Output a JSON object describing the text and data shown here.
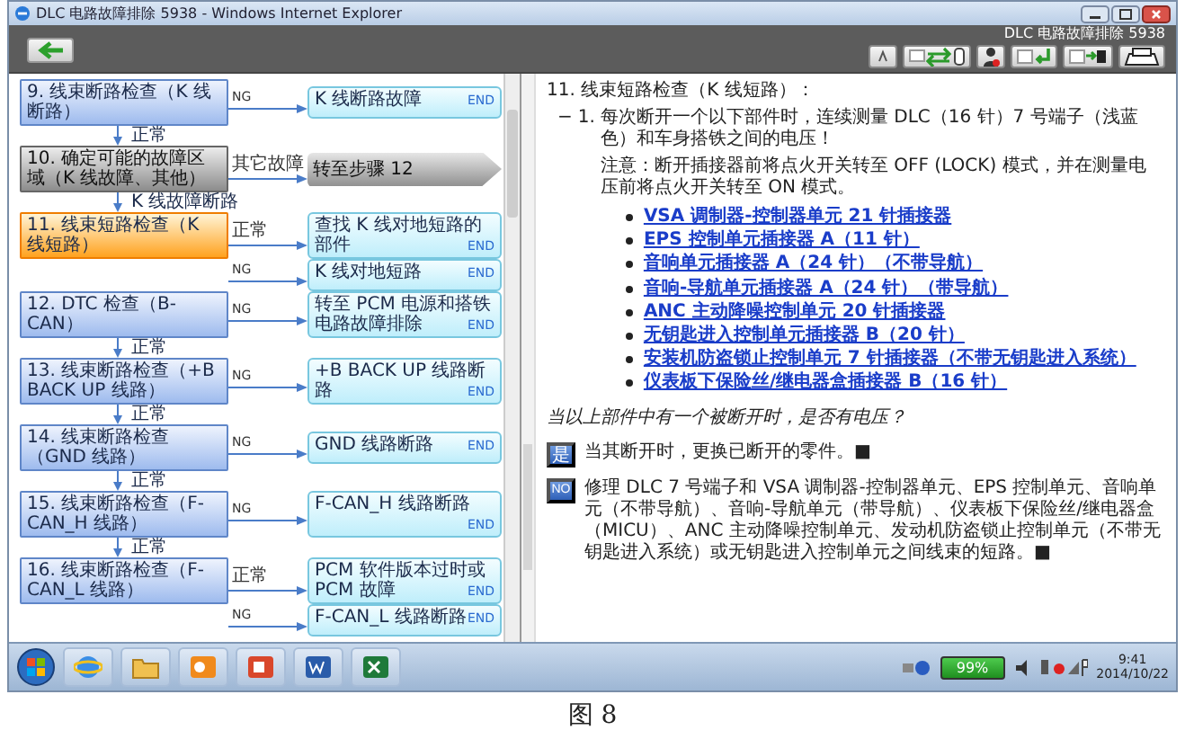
{
  "window": {
    "title": "DLC 电路故障排除 5938 - Windows Internet Explorer"
  },
  "toolbar": {
    "title": "DLC 电路故障排除 5938"
  },
  "flow": {
    "steps": [
      {
        "text": "9. 线束断路检查（K 线断路）",
        "kind": "check",
        "current": false,
        "branches": [
          {
            "label": "NG",
            "result": "K 线断路故障",
            "kind": "end",
            "end_tag": "END"
          }
        ],
        "next": "正常"
      },
      {
        "text": "10. 确定可能的故障区域（K 线故障、其他）",
        "kind": "decision",
        "current": false,
        "branches": [
          {
            "label": "其它故障",
            "result": "转至步骤 12",
            "kind": "goto"
          }
        ],
        "next": "K 线故障断路"
      },
      {
        "text": "11. 线束短路检查（K 线短路）",
        "kind": "check",
        "current": true,
        "branches": [
          {
            "label": "正常",
            "result": "查找 K 线对地短路的部件",
            "kind": "end",
            "end_tag": "END"
          },
          {
            "label": "NG",
            "result": "K 线对地短路",
            "kind": "end",
            "end_tag": "END"
          }
        ]
      },
      {
        "text": "12. DTC 检查（B-CAN）",
        "kind": "check",
        "current": false,
        "branches": [
          {
            "label": "NG",
            "result": "转至 PCM 电源和搭铁电路故障排除",
            "kind": "end",
            "end_tag": "END"
          }
        ],
        "next": "正常"
      },
      {
        "text": "13. 线束断路检查（+B BACK UP 线路）",
        "kind": "check",
        "current": false,
        "branches": [
          {
            "label": "NG",
            "result": "+B BACK UP 线路断路",
            "kind": "end",
            "end_tag": "END"
          }
        ],
        "next": "正常"
      },
      {
        "text": "14. 线束断路检查（GND 线路）",
        "kind": "check",
        "current": false,
        "branches": [
          {
            "label": "NG",
            "result": "GND 线路断路",
            "kind": "end",
            "end_tag": "END"
          }
        ],
        "next": "正常"
      },
      {
        "text": "15. 线束断路检查（F-CAN_H 线路）",
        "kind": "check",
        "current": false,
        "branches": [
          {
            "label": "NG",
            "result": "F-CAN_H 线路断路",
            "kind": "end",
            "end_tag": "END"
          }
        ],
        "next": "正常"
      },
      {
        "text": "16. 线束断路检查（F-CAN_L 线路）",
        "kind": "check",
        "current": false,
        "branches": [
          {
            "label": "正常",
            "result": "PCM 软件版本过时或 PCM 故障",
            "kind": "end",
            "end_tag": "END"
          },
          {
            "label": "NG",
            "result": "F-CAN_L 线路断路",
            "kind": "end",
            "end_tag": "END"
          }
        ]
      }
    ]
  },
  "article": {
    "heading": "11. 线束短路检查（K 线短路）：",
    "toggle": "−",
    "number": "1.",
    "instruction": "每次断开一个以下部件时，连续测量 DLC（16 针）7 号端子（浅蓝色）和车身搭铁之间的电压！",
    "note": "注意：断开插接器前将点火开关转至 OFF (LOCK) 模式，并在测量电压前将点火开关转至 ON 模式。",
    "links": [
      "VSA 调制器-控制器单元 21 针插接器",
      "EPS 控制单元插接器 A（11 针）",
      "音响单元插接器 A（24 针）（不带导航）",
      "音响-导航单元插接器 A（24 针）（带导航）",
      "ANC 主动降噪控制单元 20 针插接器",
      "无钥匙进入控制单元插接器 B（20 针）",
      "安装机防盗锁止控制单元 7 针插接器（不带无钥匙进入系统）",
      "仪表板下保险丝/继电器盒插接器 B（16 针）"
    ],
    "question": "当以上部件中有一个被断开时，是否有电压？",
    "answers": [
      {
        "badge": "是",
        "text": "当其断开时，更换已断开的零件。■"
      },
      {
        "badge": "NO",
        "text": "修理 DLC 7 号端子和 VSA 调制器-控制器单元、EPS 控制单元、音响单元（不带导航）、音响-导航单元（带导航）、仪表板下保险丝/继电器盒（MICU）、ANC 主动降噪控制单元、发动机防盗锁止控制单元（不带无钥匙进入系统）或无钥匙进入控制单元之间线束的短路。■"
      }
    ]
  },
  "tray": {
    "battery": "99%",
    "time": "9:41",
    "date": "2014/10/22"
  },
  "caption": "图 8"
}
